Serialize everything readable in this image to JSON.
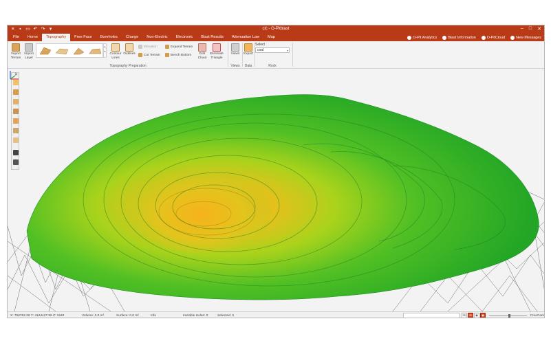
{
  "titlebar": {
    "title": "clc - O-Pitblast",
    "quick_access_icons": [
      "menu-icon",
      "save-icon",
      "folder-icon",
      "undo-icon",
      "redo-icon",
      "dropdown-icon"
    ]
  },
  "tabs": [
    "File",
    "Home",
    "Topography",
    "Free Face",
    "Boreholes",
    "Charge",
    "Non-Electric",
    "Electronic",
    "Blast Results",
    "Attenuation Law",
    "Map"
  ],
  "active_tab": "Topography",
  "right_links": [
    {
      "label": "O-Pit Analytics",
      "icon": "analytics-icon"
    },
    {
      "label": "Blast Information",
      "icon": "info-icon"
    },
    {
      "label": "O-PitCloud",
      "icon": "cloud-icon"
    },
    {
      "label": "New Messages",
      "icon": "mail-icon"
    }
  ],
  "ribbon": {
    "import_terrain": "Import Terrain",
    "import_layer": "Import Layer",
    "contour_lines": "Contour Lines",
    "outlines": "Outlines",
    "elevation": "Elevation",
    "cut_terrain": "Cut Terrain",
    "expand_terrain": "Expand Terrain",
    "bench_bottom": "Bench Bottom",
    "edit_cloud": "Edit Cloud",
    "eliminate_triangle": "Eliminate Triangle",
    "views": "Views",
    "export": "Export",
    "groups": [
      "Topography Preparation",
      "Views",
      "Data",
      "Rock"
    ],
    "select_label": "Select",
    "select_value": "coal"
  },
  "status": {
    "coords": "X: 756762.29   Y: 4164427.55   Z: 1540",
    "volume": "Volume: 0.0 m³",
    "surface": "Surface: 0.0 m²",
    "info": "Info",
    "invisible_holes": "Invisible Holes: 0",
    "selected": "Selected: 0",
    "view_2d": "2D",
    "view_3d": "3D",
    "camera": "FreeCam"
  },
  "colors": {
    "brand": "#b83a17",
    "terrain_low": "#2fb52a",
    "terrain_mid": "#9bd11c",
    "terrain_high": "#f2b21a"
  }
}
